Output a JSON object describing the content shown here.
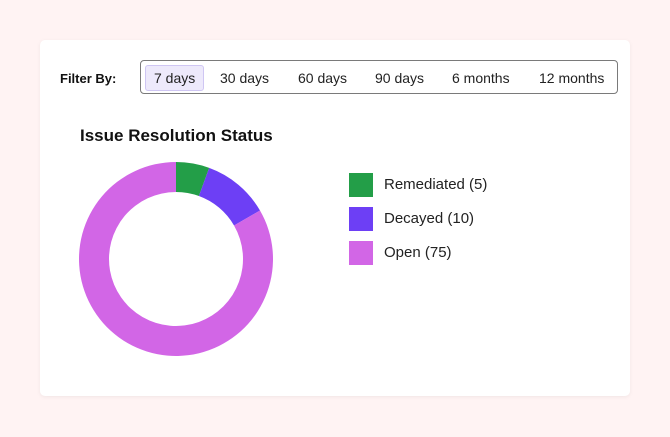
{
  "filter": {
    "label": "Filter By:",
    "options": [
      "7 days",
      "30 days",
      "60 days",
      "90 days",
      "6 months",
      "12 months"
    ],
    "selected": "7 days"
  },
  "chart_data": {
    "type": "pie",
    "style": "donut",
    "title": "Issue Resolution Status",
    "categories": [
      "Remediated",
      "Decayed",
      "Open"
    ],
    "values": [
      5,
      10,
      75
    ],
    "colors": [
      "#239e48",
      "#6d3ff5",
      "#d266e6"
    ],
    "legend_labels": [
      "Remediated (5)",
      "Decayed (10)",
      "Open (75)"
    ],
    "legend_position": "right"
  }
}
